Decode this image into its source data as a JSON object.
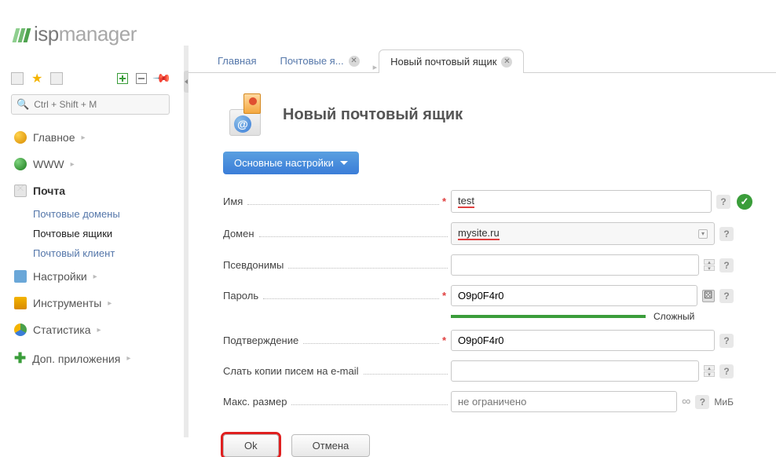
{
  "logo": {
    "part1": "isp",
    "part2": "manager"
  },
  "search": {
    "placeholder": "Ctrl + Shift + M"
  },
  "nav": {
    "main": "Главное",
    "www": "WWW",
    "mail": "Почта",
    "mail_sub": {
      "domains": "Почтовые домены",
      "boxes": "Почтовые ящики",
      "client": "Почтовый клиент"
    },
    "settings": "Настройки",
    "tools": "Инструменты",
    "stats": "Статистика",
    "apps": "Доп. приложения"
  },
  "tabs": {
    "t1": "Главная",
    "t2": "Почтовые я...",
    "t3": "Новый почтовый ящик"
  },
  "page": {
    "title": "Новый почтовый ящик",
    "section": "Основные настройки"
  },
  "form": {
    "name_label": "Имя",
    "name_value": "test",
    "domain_label": "Домен",
    "domain_value": "mysite.ru",
    "aliases_label": "Псевдонимы",
    "aliases_value": "",
    "password_label": "Пароль",
    "password_value": "O9p0F4r0",
    "strength": "Сложный",
    "confirm_label": "Подтверждение",
    "confirm_value": "O9p0F4r0",
    "copies_label": "Слать копии писем на e-mail",
    "copies_value": "",
    "maxsize_label": "Макс. размер",
    "maxsize_placeholder": "не ограничено",
    "maxsize_unit": "МиБ"
  },
  "buttons": {
    "ok": "Ok",
    "cancel": "Отмена"
  }
}
